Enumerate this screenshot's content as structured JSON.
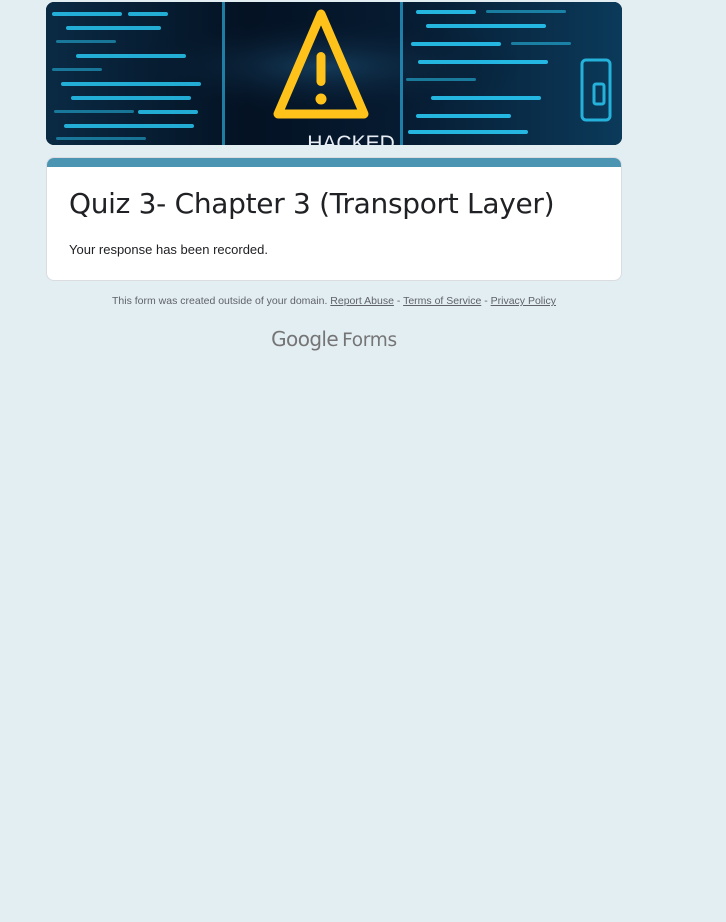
{
  "header_image": {
    "overlay_text": "HACKED",
    "colors": {
      "background": "#06121f",
      "code_lines": "#29c7f2",
      "warning": "#ffc21a"
    }
  },
  "form": {
    "title": "Quiz 3- Chapter 3 (Transport Layer)",
    "confirmation_message": "Your response has been recorded.",
    "accent_color": "#4b95b3"
  },
  "footer": {
    "notice": "This form was created outside of your domain.",
    "report_abuse": "Report Abuse",
    "separator": "-",
    "terms_of_service": "Terms of Service",
    "privacy_policy": "Privacy Policy"
  },
  "branding": {
    "google": "Google",
    "forms": "Forms"
  },
  "page_background": "#e3eef3"
}
